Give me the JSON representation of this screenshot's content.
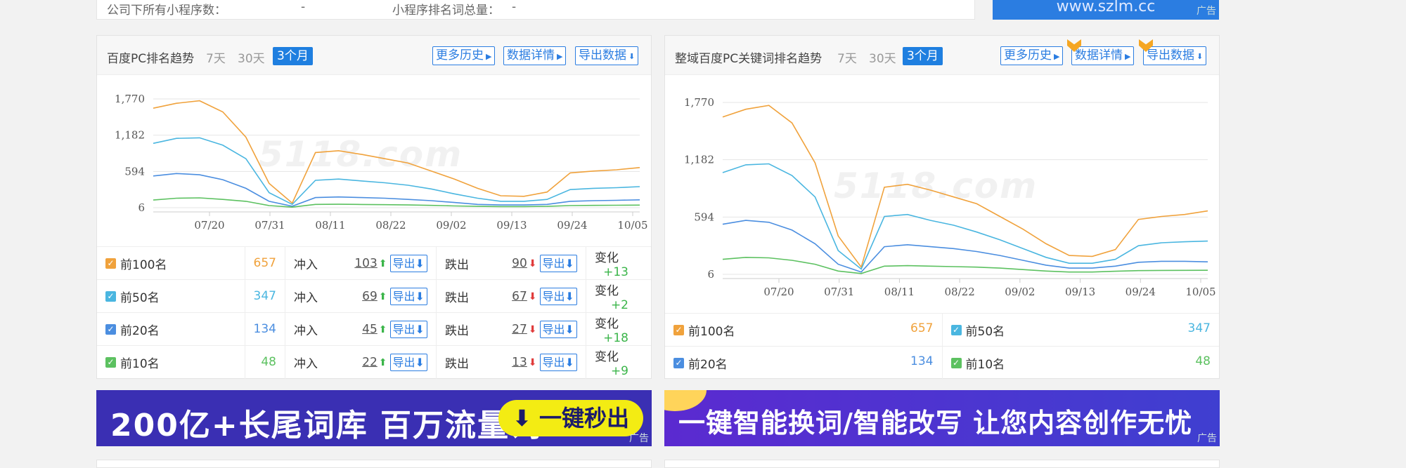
{
  "top": {
    "label1": "公司下所有小程序数：",
    "value1": "-",
    "label2": "小程序排名词总量：",
    "value2": "-",
    "ad_url": "www.szlm.cc",
    "ad_tag": "广告"
  },
  "left_panel": {
    "title": "百度PC排名趋势",
    "ranges": [
      "7天",
      "30天",
      "3个月"
    ],
    "buttons": {
      "history": "更多历史",
      "details": "数据详情",
      "export": "导出数据"
    },
    "watermark": "5118.com",
    "rows": [
      {
        "label": "前100名",
        "count": "657",
        "in_label": "冲入",
        "in": "103",
        "out_label": "跌出",
        "out": "90",
        "chg_label": "变化",
        "chg": "+13",
        "export": "导出"
      },
      {
        "label": "前50名",
        "count": "347",
        "in_label": "冲入",
        "in": "69",
        "out_label": "跌出",
        "out": "67",
        "chg_label": "变化",
        "chg": "+2",
        "export": "导出"
      },
      {
        "label": "前20名",
        "count": "134",
        "in_label": "冲入",
        "in": "45",
        "out_label": "跌出",
        "out": "27",
        "chg_label": "变化",
        "chg": "+18",
        "export": "导出"
      },
      {
        "label": "前10名",
        "count": "48",
        "in_label": "冲入",
        "in": "22",
        "out_label": "跌出",
        "out": "13",
        "chg_label": "变化",
        "chg": "+9",
        "export": "导出"
      }
    ]
  },
  "right_panel": {
    "title": "整域百度PC关键词排名趋势",
    "ranges": [
      "7天",
      "30天",
      "3个月"
    ],
    "buttons": {
      "history": "更多历史",
      "details": "数据详情",
      "export": "导出数据"
    },
    "watermark": "5118.com",
    "cells": [
      {
        "label": "前100名",
        "count": "657"
      },
      {
        "label": "前50名",
        "count": "347"
      },
      {
        "label": "前20名",
        "count": "134"
      },
      {
        "label": "前10名",
        "count": "48"
      }
    ]
  },
  "banners": {
    "left_text": "200亿+长尾词库  百万流量词",
    "left_button": "⬇ 一键秒出",
    "right_text": "一键智能换词/智能改写 让您内容创作无忧",
    "tag": "广告"
  },
  "colors": {
    "top100": "#f0a23c",
    "top50": "#4ab6e0",
    "top20": "#4b8ee0",
    "top10": "#5cc160",
    "accent": "#1f7fe0"
  },
  "chart_data": [
    {
      "type": "line",
      "title": "百度PC排名趋势",
      "x_ticks": [
        "07/20",
        "07/31",
        "08/11",
        "08/22",
        "09/02",
        "09/13",
        "09/24",
        "10/05"
      ],
      "y_ticks": [
        6,
        594,
        1182,
        1770
      ],
      "ylim": [
        6,
        1770
      ],
      "series": [
        {
          "name": "前100名",
          "color": "#f0a23c",
          "values": [
            1620,
            1700,
            1740,
            1560,
            1150,
            400,
            80,
            900,
            930,
            870,
            800,
            730,
            600,
            470,
            320,
            200,
            190,
            260,
            570,
            600,
            620,
            657
          ]
        },
        {
          "name": "前50名",
          "color": "#4ab6e0",
          "values": [
            1050,
            1130,
            1140,
            1020,
            800,
            250,
            60,
            450,
            470,
            440,
            410,
            370,
            310,
            230,
            160,
            110,
            110,
            140,
            300,
            320,
            330,
            347
          ]
        },
        {
          "name": "前20名",
          "color": "#4b8ee0",
          "values": [
            520,
            560,
            540,
            460,
            320,
            110,
            30,
            170,
            180,
            170,
            160,
            140,
            120,
            90,
            60,
            50,
            50,
            60,
            110,
            120,
            125,
            134
          ]
        },
        {
          "name": "前10名",
          "color": "#5cc160",
          "values": [
            130,
            160,
            165,
            140,
            110,
            40,
            15,
            60,
            62,
            58,
            55,
            50,
            44,
            35,
            28,
            24,
            24,
            28,
            40,
            44,
            46,
            48
          ]
        }
      ]
    },
    {
      "type": "line",
      "title": "整域百度PC关键词排名趋势",
      "x_ticks": [
        "07/20",
        "07/31",
        "08/11",
        "08/22",
        "09/02",
        "09/13",
        "09/24",
        "10/05"
      ],
      "y_ticks": [
        6,
        594,
        1182,
        1770
      ],
      "ylim": [
        6,
        1770
      ],
      "series": [
        {
          "name": "前100名",
          "color": "#f0a23c",
          "values": [
            1620,
            1700,
            1740,
            1560,
            1150,
            400,
            80,
            900,
            930,
            870,
            800,
            730,
            600,
            470,
            320,
            200,
            190,
            260,
            570,
            600,
            620,
            657
          ]
        },
        {
          "name": "前50名",
          "color": "#4ab6e0",
          "values": [
            1050,
            1130,
            1140,
            1020,
            800,
            250,
            60,
            600,
            620,
            560,
            510,
            440,
            360,
            270,
            180,
            120,
            120,
            160,
            300,
            330,
            340,
            347
          ]
        },
        {
          "name": "前20名",
          "color": "#4b8ee0",
          "values": [
            520,
            560,
            540,
            460,
            320,
            110,
            30,
            290,
            310,
            290,
            270,
            240,
            200,
            150,
            100,
            70,
            70,
            90,
            130,
            140,
            140,
            134
          ]
        },
        {
          "name": "前10名",
          "color": "#5cc160",
          "values": [
            160,
            180,
            175,
            150,
            110,
            40,
            15,
            90,
            95,
            90,
            85,
            80,
            70,
            55,
            40,
            30,
            30,
            38,
            44,
            46,
            47,
            48
          ]
        }
      ]
    }
  ]
}
